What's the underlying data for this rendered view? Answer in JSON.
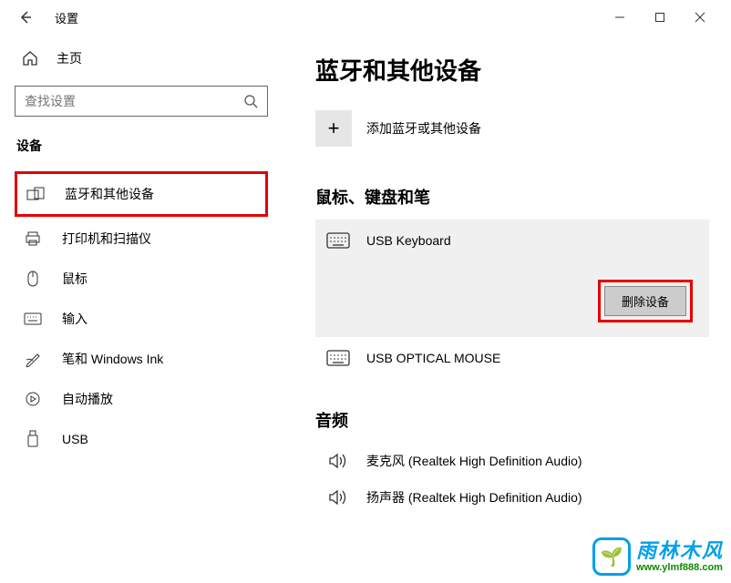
{
  "window": {
    "title": "设置"
  },
  "sidebar": {
    "home_label": "主页",
    "search_placeholder": "查找设置",
    "category": "设备",
    "items": [
      {
        "label": "蓝牙和其他设备"
      },
      {
        "label": "打印机和扫描仪"
      },
      {
        "label": "鼠标"
      },
      {
        "label": "输入"
      },
      {
        "label": "笔和 Windows Ink"
      },
      {
        "label": "自动播放"
      },
      {
        "label": "USB"
      }
    ]
  },
  "main": {
    "page_title": "蓝牙和其他设备",
    "add_device_label": "添加蓝牙或其他设备",
    "section_mouse_keyboard": "鼠标、键盘和笔",
    "devices": [
      {
        "name": "USB Keyboard"
      },
      {
        "name": "USB OPTICAL MOUSE"
      }
    ],
    "remove_device_label": "删除设备",
    "section_audio": "音频",
    "audio_devices": [
      {
        "name": "麦克风 (Realtek High Definition Audio)"
      },
      {
        "name": "扬声器 (Realtek High Definition Audio)"
      }
    ]
  },
  "watermark": {
    "chinese": "雨林木风",
    "url": "www.ylmf888.com"
  }
}
